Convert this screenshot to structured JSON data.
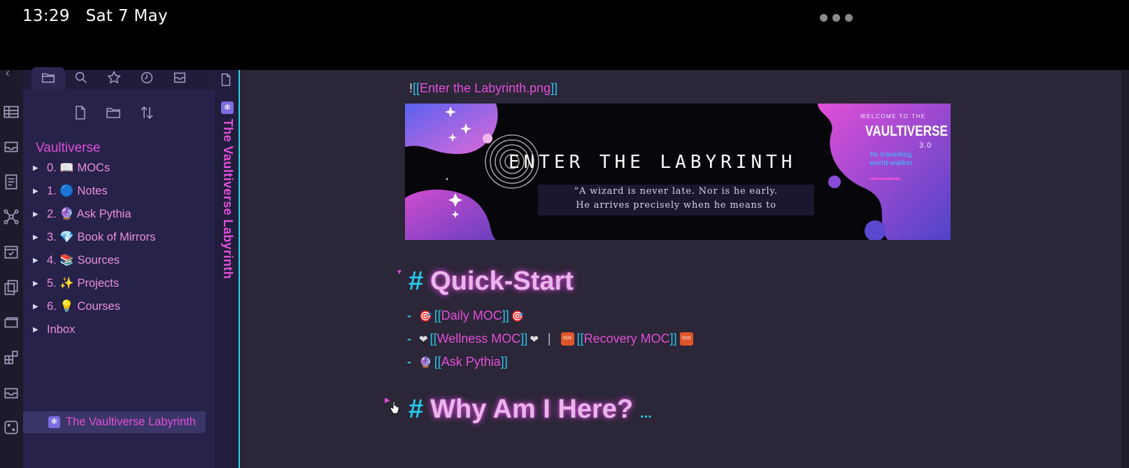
{
  "status_bar": {
    "time": "13:29",
    "date": "Sat 7 May"
  },
  "sidebar": {
    "tabs": [
      "files-icon",
      "search-icon",
      "star-icon",
      "clock-icon",
      "inbox-icon"
    ],
    "actions": [
      "new-note-icon",
      "new-folder-icon",
      "sort-icon"
    ],
    "vault_name": "Vaultiverse",
    "items": [
      {
        "label": "0. 📖 MOCs"
      },
      {
        "label": "1. 🔵 Notes"
      },
      {
        "label": "2. 🔮 Ask Pythia"
      },
      {
        "label": "3. 💎 Book of Mirrors"
      },
      {
        "label": "4. 📚 Sources"
      },
      {
        "label": "5. ✨ Projects"
      },
      {
        "label": "6. 💡 Courses"
      },
      {
        "label": "Inbox"
      }
    ],
    "active_file": "The Vaultiverse Labyrinth"
  },
  "tab_strip": {
    "title": "The Vaultiverse Labyrinth"
  },
  "editor": {
    "embed": {
      "excl": "!",
      "open": "[[",
      "target": "Enter the Labyrinth.png",
      "close": "]]"
    },
    "banner": {
      "title": "ENTER THE LABYRINTH",
      "quote_line1": "\"A wizard is never late. Nor is he early.",
      "quote_line2": "He arrives precisely when he means to",
      "welcome": "WELCOME TO THE",
      "brand": "VAULTIVERSE",
      "version": "3.0",
      "tagline_1": "Ye travelling",
      "tagline_2": "world-walker",
      "colors": {
        "pink": "#e24fd8",
        "purple": "#6f4fe0",
        "cyan": "#30d0ff"
      }
    },
    "heading1": {
      "hash": "#",
      "text": "Quick-Start"
    },
    "list": [
      {
        "dash": "-",
        "open": "[[",
        "link": "Daily MOC",
        "close": "]]"
      },
      {
        "dash": "-",
        "open": "[[",
        "link": "Wellness MOC",
        "close": "]]",
        "pipe": "|",
        "open2": "[[",
        "link2": "Recovery MOC",
        "close2": "]]",
        "sos": "SOS"
      },
      {
        "dash": "-",
        "open": "[[",
        "link": "Ask Pythia",
        "close": "]]"
      }
    ],
    "heading2": {
      "hash": "#",
      "text": "Why Am I Here?",
      "ellipsis": "..."
    }
  }
}
